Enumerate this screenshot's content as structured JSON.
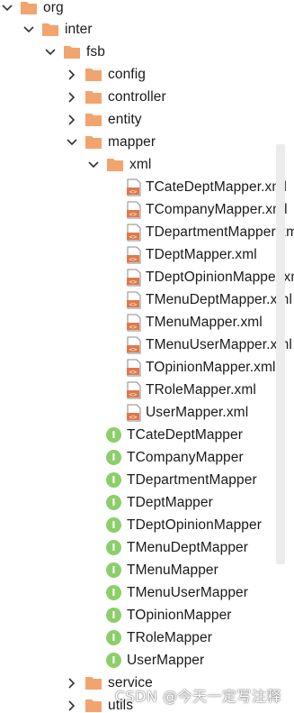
{
  "tree": {
    "org": {
      "label": "org"
    },
    "inter": {
      "label": "inter"
    },
    "fsb": {
      "label": "fsb"
    },
    "config": {
      "label": "config"
    },
    "controller": {
      "label": "controller"
    },
    "entity": {
      "label": "entity"
    },
    "mapper": {
      "label": "mapper"
    },
    "xml": {
      "label": "xml"
    },
    "xml_files": [
      "TCateDeptMapper.xml",
      "TCompanyMapper.xml",
      "TDepartmentMapper.xml",
      "TDeptMapper.xml",
      "TDeptOpinionMapper.xml",
      "TMenuDeptMapper.xml",
      "TMenuMapper.xml",
      "TMenuUserMapper.xml",
      "TOpinionMapper.xml",
      "TRoleMapper.xml",
      "UserMapper.xml"
    ],
    "interfaces": [
      "TCateDeptMapper",
      "TCompanyMapper",
      "TDepartmentMapper",
      "TDeptMapper",
      "TDeptOpinionMapper",
      "TMenuDeptMapper",
      "TMenuMapper",
      "TMenuUserMapper",
      "TOpinionMapper",
      "TRoleMapper",
      "UserMapper"
    ],
    "service": {
      "label": "service"
    },
    "utils": {
      "label": "utils"
    }
  },
  "watermark": "CSDN @今天一定写注释",
  "colors": {
    "folder": "#f2a46f",
    "folder_dark": "#e8945b",
    "interface_badge": "#8ccf6a",
    "xml_badge": "#e0784a",
    "arrow": "#333333"
  },
  "icons": {
    "expanded": "chevron-down-icon",
    "collapsed": "chevron-right-icon",
    "folder": "folder-icon",
    "xml": "xml-file-icon",
    "interface": "interface-icon"
  }
}
